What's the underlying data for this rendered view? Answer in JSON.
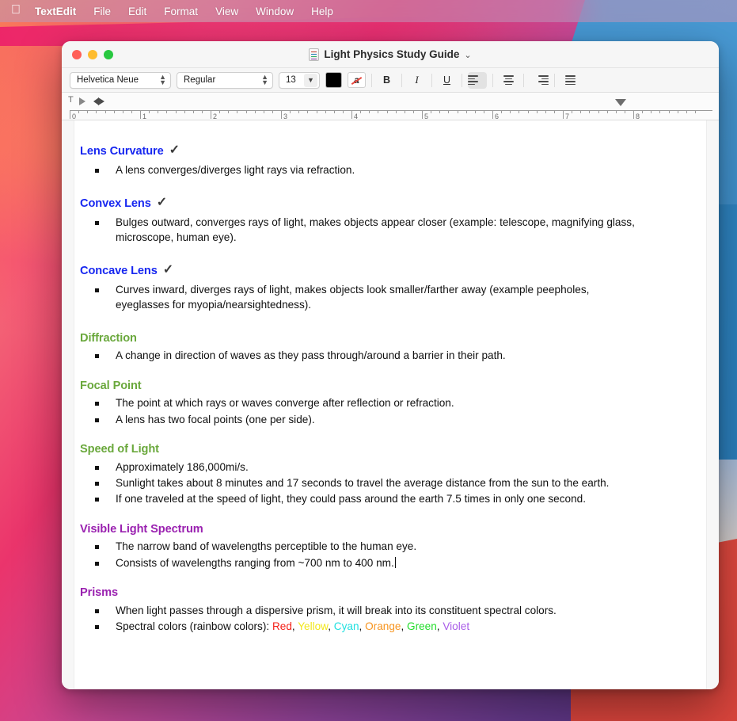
{
  "menubar": {
    "apple_icon": "apple-logo",
    "items": [
      {
        "label": "TextEdit",
        "bold": true
      },
      {
        "label": "File"
      },
      {
        "label": "Edit"
      },
      {
        "label": "Format"
      },
      {
        "label": "View"
      },
      {
        "label": "Window"
      },
      {
        "label": "Help"
      }
    ]
  },
  "window": {
    "title": "Light Physics Study Guide",
    "title_chevron": "⌄",
    "traffic_lights": {
      "close": "close-button",
      "minimize": "minimize-button",
      "maximize": "maximize-button"
    }
  },
  "toolbar": {
    "font_family": "Helvetica Neue",
    "font_style": "Regular",
    "font_size": "13",
    "size_chevron": "⌄",
    "updown_glyph": "⌃⌄",
    "color_swatch_hex": "#000000",
    "text_color_label": "a",
    "bold_label": "B",
    "italic_label": "I",
    "underline_label": "U",
    "align_left": "align-left",
    "align_center": "align-center",
    "align_right": "align-right",
    "align_justify": "align-justify",
    "active_alignment": "align-left"
  },
  "ruler": {
    "tab_stop_glyph": "T",
    "labels": [
      "0",
      "1",
      "2",
      "3",
      "4",
      "5",
      "6",
      "7",
      "8"
    ]
  },
  "document": {
    "sections": [
      {
        "heading": "Lens Curvature",
        "check": "✓",
        "color": "blue",
        "bullets": [
          "A lens converges/diverges light rays via refraction."
        ]
      },
      {
        "heading": "Convex Lens",
        "check": "✓",
        "color": "blue",
        "bullets": [
          "Bulges outward, converges rays of light, makes objects appear closer (example: telescope, magnifying glass, microscope, human eye)."
        ]
      },
      {
        "heading": "Concave Lens",
        "check": "✓",
        "color": "blue",
        "bullets": [
          "Curves inward, diverges rays of light, makes objects look smaller/farther away (example peepholes, eyeglasses for myopia/nearsightedness)."
        ]
      },
      {
        "heading": "Diffraction",
        "check": "",
        "color": "green",
        "bullets": [
          "A change in direction of waves as they pass through/around a barrier in their path."
        ]
      },
      {
        "heading": "Focal Point",
        "check": "",
        "color": "green",
        "bullets": [
          "The point at which rays or waves converge after reflection or refraction.",
          "A lens has two focal points (one per side)."
        ]
      },
      {
        "heading": "Speed of Light",
        "check": "",
        "color": "green",
        "bullets": [
          "Approximately 186,000mi/s.",
          "Sunlight takes about 8 minutes and 17 seconds to travel the average distance from the sun to the earth.",
          "If one traveled at the speed of light, they could pass around the earth 7.5 times in only one second."
        ]
      },
      {
        "heading": "Visible Light Spectrum",
        "check": "",
        "color": "purple",
        "bullets": [
          "The narrow band of wavelengths perceptible to the human eye.",
          "Consists of wavelengths ranging from ~700 nm to 400 nm."
        ]
      },
      {
        "heading": "Prisms",
        "check": "",
        "color": "purple",
        "bullets": [
          "When light passes through a dispersive prism, it will break into its constituent spectral colors."
        ]
      }
    ],
    "spectral_line": {
      "prefix": "Spectral colors (rainbow colors): ",
      "colors": [
        {
          "name": "Red",
          "hex": "#f41f17"
        },
        {
          "name": "Yellow",
          "hex": "#f2e71b"
        },
        {
          "name": "Cyan",
          "hex": "#1fe0e0"
        },
        {
          "name": "Orange",
          "hex": "#f79520"
        },
        {
          "name": "Green",
          "hex": "#23dd2b"
        },
        {
          "name": "Violet",
          "hex": "#a95ce8"
        }
      ],
      "separator": ", "
    },
    "heading_colors": {
      "blue": "#1727f0",
      "green": "#6aa83c",
      "purple": "#9a21b0"
    }
  }
}
